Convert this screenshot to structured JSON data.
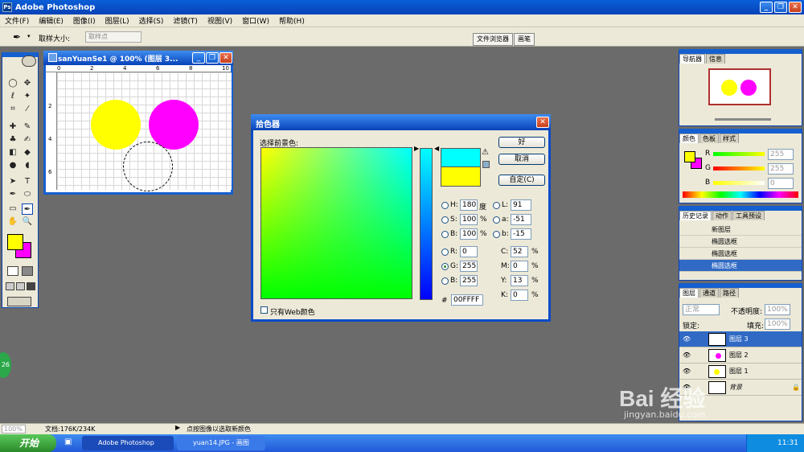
{
  "app": {
    "title": "Adobe Photoshop"
  },
  "menu": [
    "文件(F)",
    "编辑(E)",
    "图像(I)",
    "图层(L)",
    "选择(S)",
    "滤镜(T)",
    "视图(V)",
    "窗口(W)",
    "帮助(H)"
  ],
  "options": {
    "sample_label": "取样大小:",
    "sample_value": "取样点"
  },
  "right_tabs": [
    "文件浏览器",
    "画笔"
  ],
  "document": {
    "title": "sanYuanSe1 @ 100% (图层 3...",
    "ruler_h": [
      "0",
      "2",
      "4",
      "6",
      "8",
      "10"
    ],
    "ruler_v": [
      "2",
      "4",
      "6"
    ]
  },
  "picker": {
    "title": "拾色器",
    "select_label": "选择前景色:",
    "btn_ok": "好",
    "btn_cancel": "取消",
    "btn_custom": "自定(C)",
    "H": "180",
    "H_unit": "度",
    "S": "100",
    "S_unit": "%",
    "B": "100",
    "B_unit": "%",
    "R": "0",
    "G": "255",
    "Bv": "255",
    "L": "91",
    "a": "-51",
    "b": "-15",
    "C": "52",
    "M": "0",
    "Y": "13",
    "K": "0",
    "pct": "%",
    "hex_label": "#",
    "hex": "00FFFF",
    "web_only": "只有Web颜色",
    "labels": {
      "H": "H:",
      "S": "S:",
      "B": "B:",
      "R": "R:",
      "G": "G:",
      "Bb": "B:",
      "L": "L:",
      "a": "a:",
      "b": "b:",
      "C": "C:",
      "M": "M:",
      "Y": "Y:",
      "K": "K:"
    }
  },
  "navigator": {
    "tabs": [
      "导航器",
      "信息"
    ]
  },
  "color_panel": {
    "tabs": [
      "颜色",
      "色板",
      "样式"
    ],
    "R": "255",
    "G": "255",
    "B": "0",
    "lR": "R",
    "lG": "G",
    "lB": "B"
  },
  "history": {
    "tabs": [
      "历史记录",
      "动作",
      "工具预设"
    ],
    "items": [
      "新图层",
      "椭圆选框",
      "椭圆选框",
      "椭圆选框"
    ]
  },
  "layers": {
    "tabs": [
      "图层",
      "通道",
      "路径"
    ],
    "mode": "正常",
    "opacity_label": "不透明度:",
    "opacity": "100%",
    "lock_label": "锁定:",
    "fill_label": "填充:",
    "fill": "100%",
    "items": [
      "图层 3",
      "图层 2",
      "图层 1",
      "背景"
    ]
  },
  "status": {
    "zoom": "100%",
    "doc": "文档:176K/234K",
    "hint": "点按图像以选取新颜色"
  },
  "taskbar": {
    "start": "开始",
    "tasks": [
      "Adobe Photoshop",
      "yuan14.JPG - 画图"
    ],
    "clock": "11:31",
    "badge": "26"
  },
  "watermark": {
    "brand": "Bai  经验",
    "url": "jingyan.baidu.com"
  },
  "colors": {
    "yellow": "#ffff00",
    "magenta": "#ff00ff",
    "cyan": "#00ffff",
    "title_blue": "#0842b8"
  }
}
